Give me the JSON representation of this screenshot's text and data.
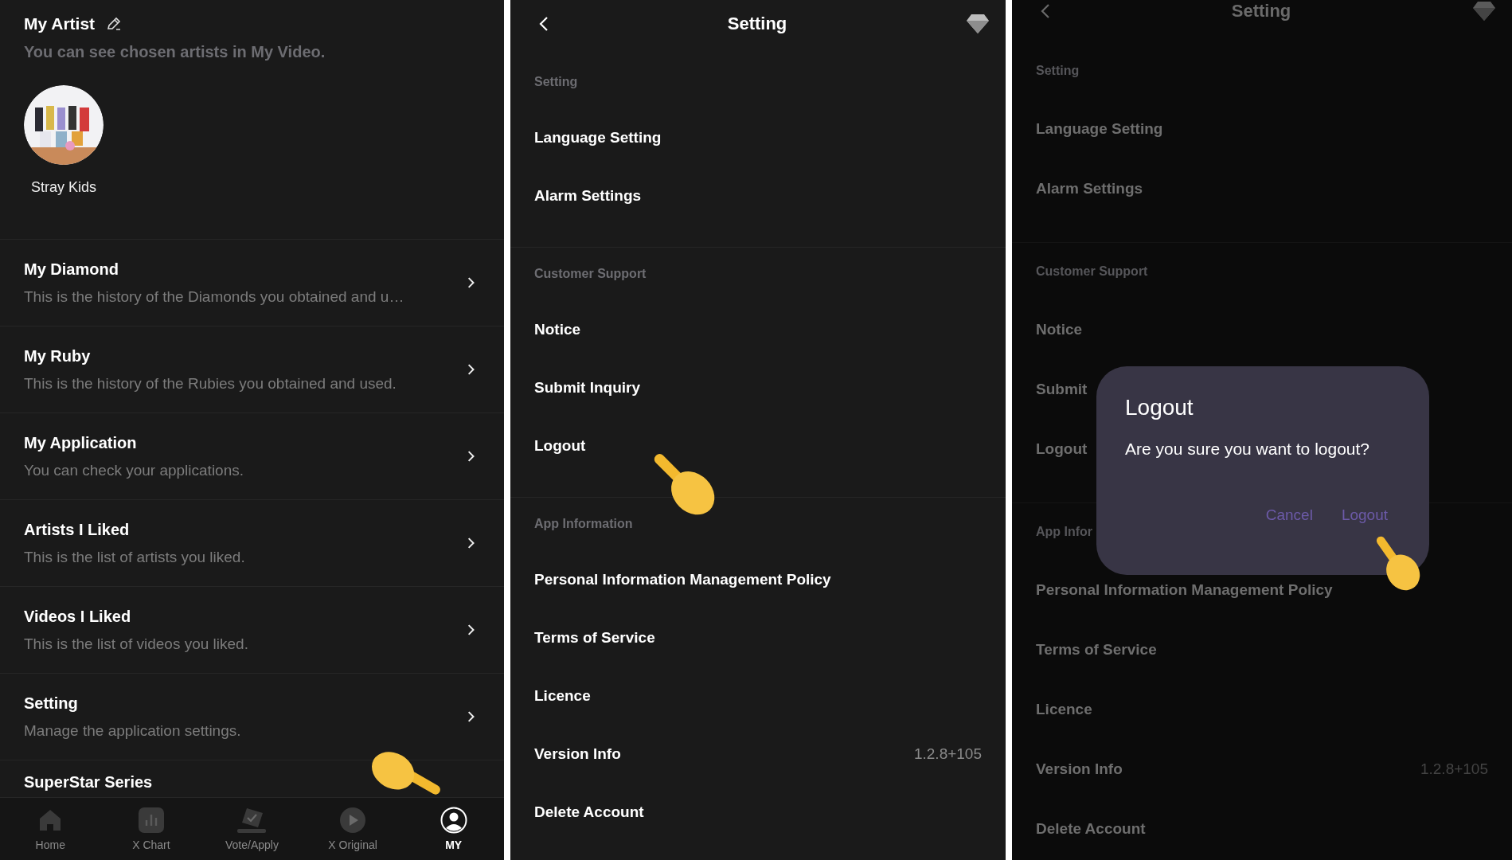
{
  "my_screen": {
    "artist_section": {
      "title": "My Artist",
      "subtitle": "You can see chosen artists in My Video."
    },
    "artists": [
      {
        "name": "Stray Kids",
        "kind": "picture"
      }
    ],
    "menu": [
      {
        "title": "My Diamond",
        "description": "This is the history of the Diamonds you obtained and u…"
      },
      {
        "title": "My Ruby",
        "description": "This is the history of the Rubies you obtained and used."
      },
      {
        "title": "My Application",
        "description": "You can check your applications."
      },
      {
        "title": "Artists I Liked",
        "description": "This is the list of artists you liked."
      },
      {
        "title": "Videos I Liked",
        "description": "This is the list of videos you liked."
      },
      {
        "title": "Setting",
        "description": "Manage the application settings."
      }
    ],
    "cut_item": "SuperStar Series",
    "bottom_nav": [
      {
        "label": "Home",
        "kind": "home",
        "selected": false
      },
      {
        "label": "X Chart",
        "kind": "chart",
        "selected": false
      },
      {
        "label": "Vote/Apply",
        "kind": "vote",
        "selected": false
      },
      {
        "label": "X Original",
        "kind": "play",
        "selected": false
      },
      {
        "label": "MY",
        "kind": "person",
        "selected": true
      }
    ]
  },
  "setting_screen": {
    "title": "Setting",
    "sections": [
      {
        "heading": "Setting",
        "items": [
          {
            "label": "Language Setting"
          },
          {
            "label": "Alarm Settings"
          }
        ]
      },
      {
        "heading": "Customer Support",
        "items": [
          {
            "label": "Notice"
          },
          {
            "label": "Submit Inquiry"
          },
          {
            "label": "Logout"
          }
        ]
      },
      {
        "heading": "App Information",
        "items": [
          {
            "label": "Personal Information Management Policy"
          },
          {
            "label": "Terms of Service"
          },
          {
            "label": "Licence"
          },
          {
            "label": "Version Info",
            "value": "1.2.8+105"
          },
          {
            "label": "Delete Account"
          }
        ]
      }
    ]
  },
  "dialog_screen": {
    "title": "Setting",
    "sections": [
      {
        "heading": "Setting",
        "items": [
          {
            "label": "Language Setting"
          },
          {
            "label": "Alarm Settings"
          }
        ]
      },
      {
        "heading": "Customer Support",
        "items": [
          {
            "label": "Notice"
          },
          {
            "label": "Submit"
          },
          {
            "label": "Logout"
          }
        ]
      },
      {
        "heading": "App Infor",
        "items": [
          {
            "label": "Personal Information Management Policy"
          },
          {
            "label": "Terms of Service"
          },
          {
            "label": "Licence"
          },
          {
            "label": "Version Info",
            "value": "1.2.8+105"
          },
          {
            "label": "Delete Account"
          }
        ]
      }
    ],
    "dialog": {
      "title": "Logout",
      "message": "Are you sure you want to logout?",
      "buttons": [
        "Cancel",
        "Logout"
      ]
    }
  }
}
